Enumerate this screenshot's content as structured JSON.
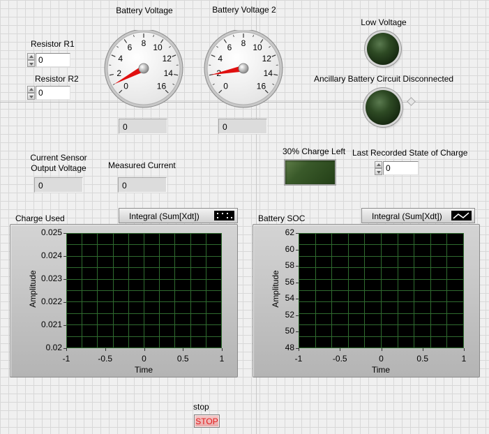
{
  "controls": {
    "resistor_r1": {
      "label": "Resistor R1",
      "value": "0"
    },
    "resistor_r2": {
      "label": "Resistor R2",
      "value": "0"
    },
    "last_soc": {
      "label": "Last Recorded State of Charge",
      "value": "0"
    }
  },
  "gauges": [
    {
      "label": "Battery Voltage",
      "ticks": [
        "0",
        "2",
        "4",
        "6",
        "8",
        "10",
        "12",
        "14",
        "16"
      ],
      "needle_value": 1,
      "min": 0,
      "max": 16,
      "readout": "0"
    },
    {
      "label": "Battery Voltage 2",
      "ticks": [
        "0",
        "2",
        "4",
        "6",
        "8",
        "10",
        "12",
        "14",
        "16"
      ],
      "needle_value": 2,
      "min": 0,
      "max": 16,
      "readout": "0"
    }
  ],
  "indicators": {
    "low_voltage": {
      "label": "Low Voltage",
      "state": "off"
    },
    "ancillary": {
      "label": "Ancillary Battery Circuit Disconnected",
      "state": "off"
    },
    "charge30": {
      "label": "30% Charge Left",
      "state": "off"
    },
    "current_sensor": {
      "label_line1": "Current Sensor",
      "label_line2": "Output Voltage",
      "value": "0"
    },
    "measured_current": {
      "label": "Measured Current",
      "value": "0"
    }
  },
  "colors": {
    "led_off": "#2e4a24",
    "plot_bg": "#000000",
    "plot_grid": "#2f6b2f",
    "needle": "#e01010",
    "stop_text": "#e21a1a"
  },
  "chart_data": [
    {
      "type": "line",
      "title": "Charge Used",
      "legend": "Integral (Sum[Xdt])",
      "legend_icon": "points-icon",
      "xlabel": "Time",
      "ylabel": "Amplitude",
      "xlim": [
        -1,
        1
      ],
      "ylim": [
        0.02,
        0.025
      ],
      "xticks": [
        "-1",
        "-0.5",
        "0",
        "0.5",
        "1"
      ],
      "yticks": [
        "0.025",
        "0.024",
        "0.023",
        "0.022",
        "0.021",
        "0.02"
      ],
      "grid": true,
      "series": []
    },
    {
      "type": "line",
      "title": "Battery SOC",
      "legend": "Integral (Sum[Xdt])",
      "legend_icon": "line-icon",
      "xlabel": "Time",
      "ylabel": "Amplitude",
      "xlim": [
        -1,
        1
      ],
      "ylim": [
        48,
        62
      ],
      "xticks": [
        "-1",
        "-0.5",
        "0",
        "0.5",
        "1"
      ],
      "yticks": [
        "62",
        "60",
        "58",
        "56",
        "54",
        "52",
        "50",
        "48"
      ],
      "grid": true,
      "series": []
    }
  ],
  "stop": {
    "label": "stop",
    "button": "STOP"
  }
}
